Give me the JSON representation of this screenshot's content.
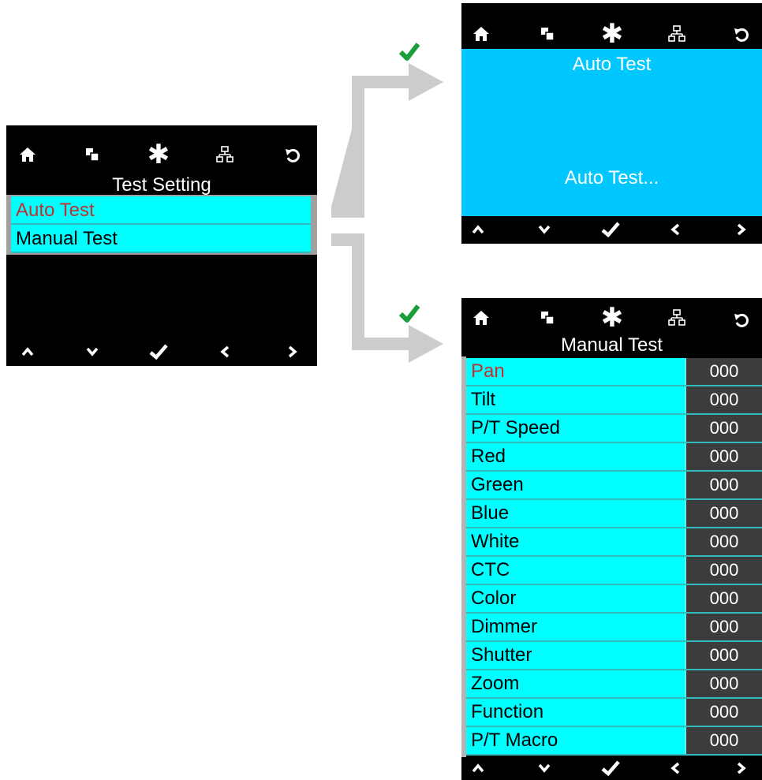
{
  "colors": {
    "row_bg": "#00ffff",
    "selected_text": "#c03030",
    "value_bg": "#3c3c3c",
    "auto_bg": "#00c8ff",
    "check_green": "#1a9e3a",
    "arrow_gray": "#cccccc"
  },
  "screen_left": {
    "title": "Test Setting",
    "items": [
      {
        "label": "Auto Test",
        "selected": true
      },
      {
        "label": "Manual Test",
        "selected": false
      }
    ]
  },
  "screen_auto": {
    "title": "Auto Test",
    "message": "Auto Test..."
  },
  "screen_manual": {
    "title": "Manual Test",
    "rows": [
      {
        "label": "Pan",
        "value": "000"
      },
      {
        "label": "Tilt",
        "value": "000"
      },
      {
        "label": "P/T Speed",
        "value": "000"
      },
      {
        "label": "Red",
        "value": "000"
      },
      {
        "label": "Green",
        "value": "000"
      },
      {
        "label": "Blue",
        "value": "000"
      },
      {
        "label": "White",
        "value": "000"
      },
      {
        "label": "CTC",
        "value": "000"
      },
      {
        "label": "Color",
        "value": "000"
      },
      {
        "label": "Dimmer",
        "value": "000"
      },
      {
        "label": "Shutter",
        "value": "000"
      },
      {
        "label": "Zoom",
        "value": "000"
      },
      {
        "label": "Function",
        "value": "000"
      },
      {
        "label": "P/T Macro",
        "value": "000"
      }
    ]
  },
  "top_icons": [
    "home-icon",
    "layers-icon",
    "asterisk-icon",
    "network-icon",
    "undo-icon"
  ],
  "bottom_icons": [
    "up-icon",
    "down-icon",
    "confirm-icon",
    "left-icon",
    "right-icon"
  ]
}
